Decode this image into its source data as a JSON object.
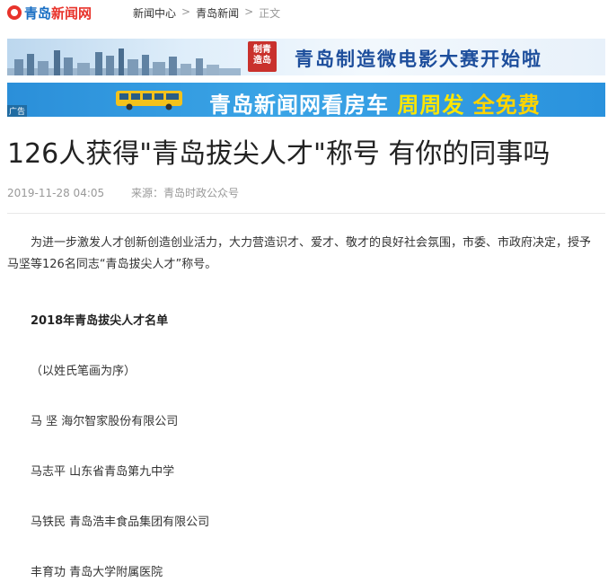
{
  "header": {
    "logo_part1": "青岛",
    "logo_part2": "新闻网",
    "breadcrumb": [
      "新闻中心",
      "青岛新闻",
      "正文"
    ],
    "breadcrumb_sep": ">"
  },
  "banners": {
    "banner1_badge": "制青\n造岛",
    "banner1_text": "青岛制造微电影大赛开始啦",
    "banner2_ad": "广告",
    "banner2_text_a": "青岛新闻网看房车 ",
    "banner2_text_b": "周周发",
    "banner2_text_c": " 全免费"
  },
  "article": {
    "title": "126人获得\"青岛拔尖人才\"称号 有你的同事吗",
    "date": "2019-11-28 04:05",
    "source": "来源：青岛时政公众号",
    "intro": "为进一步激发人才创新创造创业活力，大力营造识才、爱才、敬才的良好社会氛围，市委、市政府决定，授予马坚等126名同志“青岛拔尖人才”称号。",
    "list_title": "2018年青岛拔尖人才名单",
    "list_note": "（以姓氏笔画为序）",
    "entries": [
      "马 坚 海尔智家股份有限公司",
      "马志平 山东省青岛第九中学",
      "马铁民 青岛浩丰食品集团有限公司",
      "丰育功 青岛大学附属医院"
    ]
  },
  "colors": {
    "brand_blue": "#1a6fc4",
    "brand_red": "#e8332b",
    "banner2_bg": "#2b8fd9",
    "highlight_yellow": "#ffe600"
  }
}
